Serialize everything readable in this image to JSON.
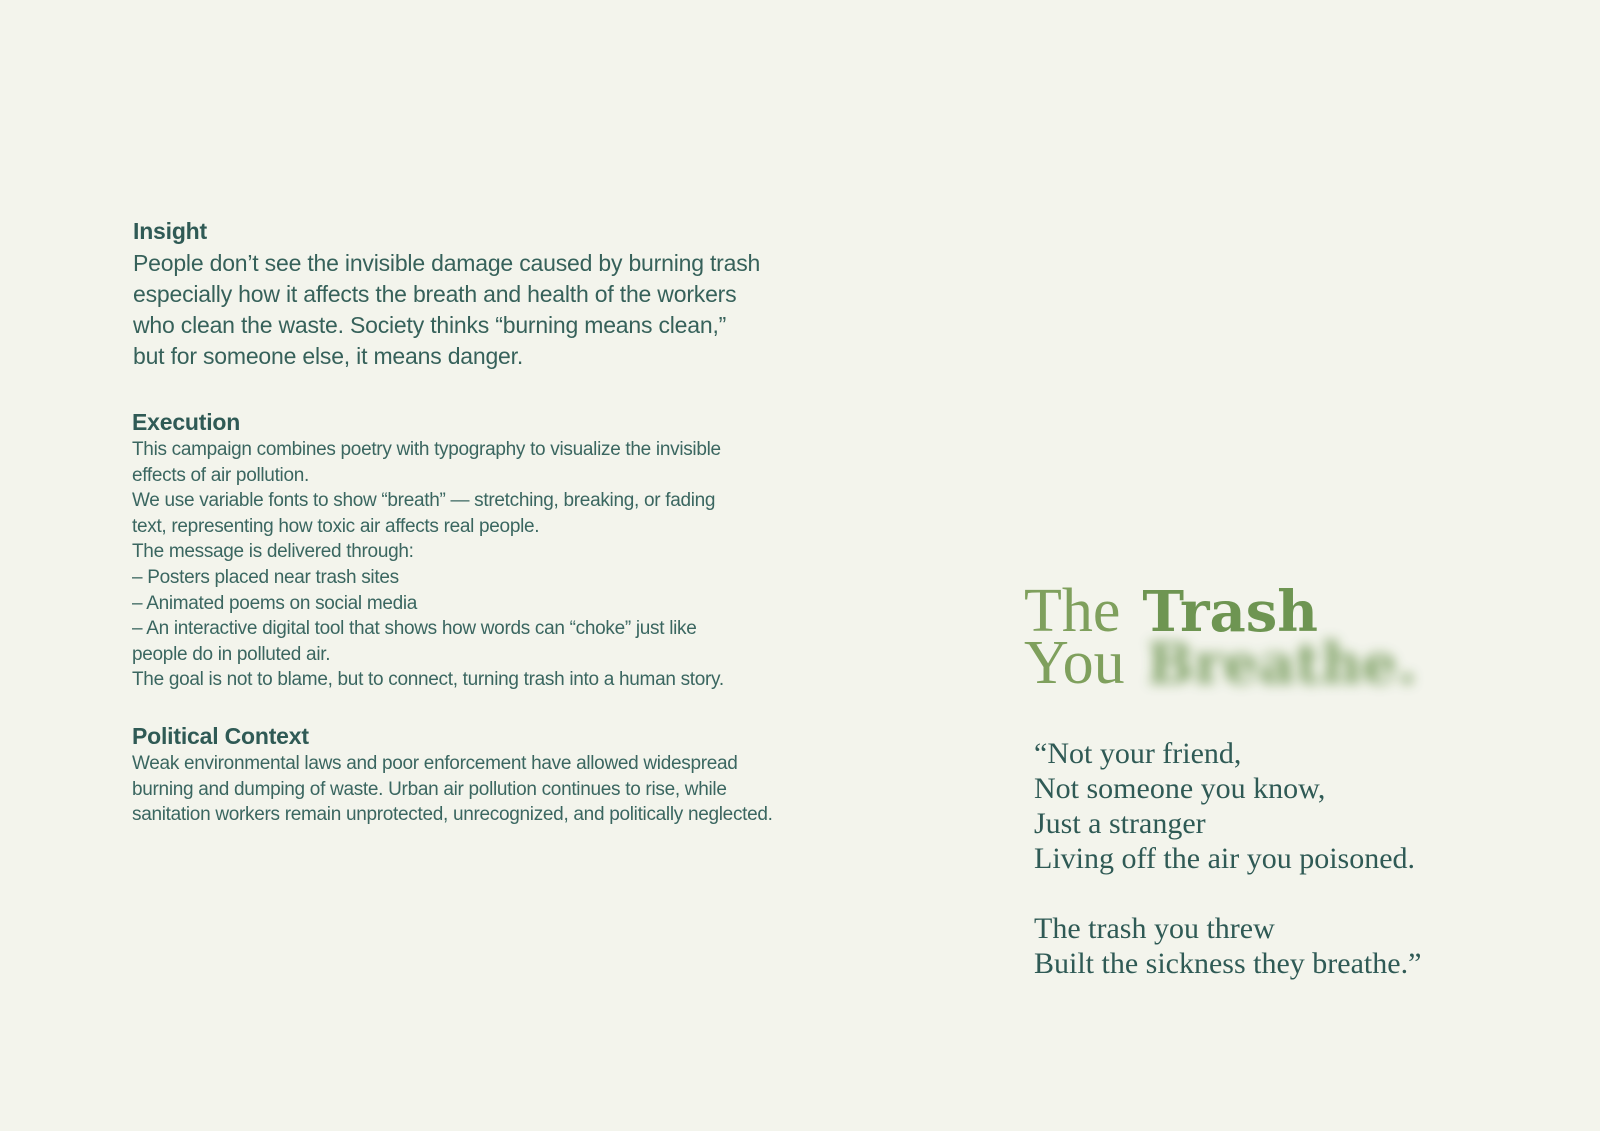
{
  "insight": {
    "title": "Insight",
    "lines": [
      "People don’t see the invisible damage caused by burning trash",
      "especially how it affects the breath and health of the workers",
      "who clean the waste. Society thinks “burning means clean,”",
      "but for someone else, it means danger."
    ]
  },
  "execution": {
    "title": "Execution",
    "lines": [
      "This campaign combines poetry with typography to visualize the invisible",
      "effects of air pollution.",
      "We use variable fonts to show “breath” — stretching, breaking, or fading",
      "text, representing how toxic air affects real people.",
      "The message is delivered through:",
      "– Posters placed near trash sites",
      "– Animated poems on social media",
      "– An interactive digital tool that shows how words can “choke” just like",
      "people do in polluted air.",
      "The goal is not to blame, but to connect, turning trash into a human story."
    ]
  },
  "political": {
    "title": "Political Context",
    "lines": [
      "Weak environmental laws and poor enforcement have allowed widespread",
      "burning and dumping of waste. Urban air pollution continues to rise, while",
      "sanitation workers remain unprotected, unrecognized, and politically neglected."
    ]
  },
  "headline": {
    "word_1": "The",
    "word_2": "Trash",
    "word_3": "You",
    "word_4": "Breathe."
  },
  "poem": {
    "stanza_1": [
      "“Not your friend,",
      "Not someone you know,",
      "Just a stranger",
      "Living off the air you poisoned."
    ],
    "stanza_2": [
      "The trash you threw",
      "Built the sickness they breathe.”"
    ]
  },
  "colors": {
    "background": "#f3f4ec",
    "text_teal": "#2f5a55",
    "headline_green": "#6e9552"
  }
}
